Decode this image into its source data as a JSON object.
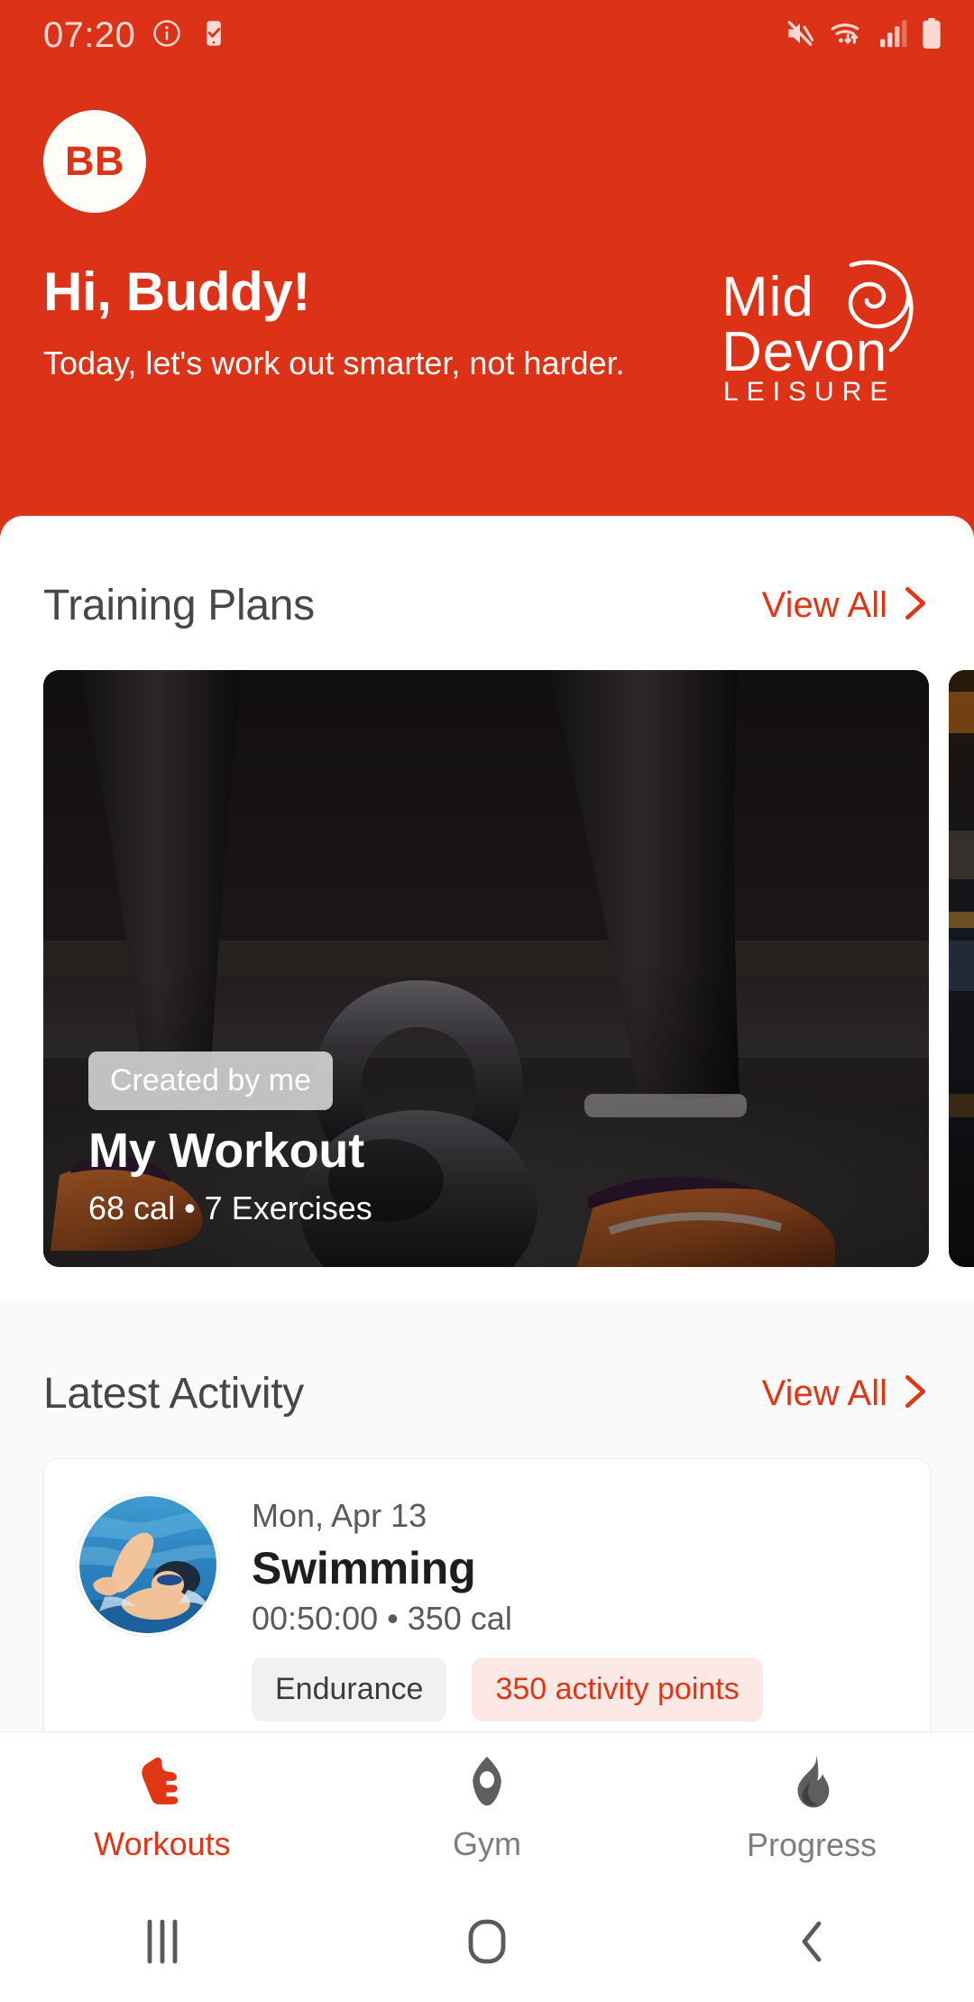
{
  "status_bar": {
    "time": "07:20",
    "left_icons": [
      "info-circle-icon",
      "phone-check-icon"
    ],
    "right_icons": [
      "mute-icon",
      "wifi-icon",
      "signal-icon",
      "battery-icon"
    ]
  },
  "header": {
    "background_color": "#DC3318",
    "avatar_initials": "BB",
    "greeting_title": "Hi, Buddy!",
    "greeting_subtitle": "Today, let's work out smarter, not harder.",
    "brand": {
      "line1": "Mid",
      "line2": "Devon",
      "line3": "LEISURE"
    }
  },
  "training_plans": {
    "section_title": "Training Plans",
    "view_all_label": "View All",
    "cards": [
      {
        "badge": "Created by me",
        "name": "My Workout",
        "meta": "68 cal • 7 Exercises",
        "image": "kettlebell-gym-photo"
      },
      {
        "badge": "",
        "name": "",
        "meta": "",
        "image": "gym-interior-photo"
      }
    ]
  },
  "latest_activity": {
    "section_title": "Latest Activity",
    "view_all_label": "View All",
    "items": [
      {
        "date": "Mon, Apr 13",
        "title": "Swimming",
        "stats": "00:50:00 • 350 cal",
        "chip_type": "Endurance",
        "chip_points": "350 activity points",
        "thumbnail": "swimmer-photo"
      }
    ]
  },
  "bottom_nav": {
    "items": [
      {
        "label": "Workouts",
        "icon": "running-shoe-icon",
        "active": true
      },
      {
        "label": "Gym",
        "icon": "location-pin-icon",
        "active": false
      },
      {
        "label": "Progress",
        "icon": "flame-icon",
        "active": false
      }
    ]
  },
  "system_nav": {
    "recents": "recents-icon",
    "home": "home-icon",
    "back": "back-icon"
  },
  "colors": {
    "brand_red": "#DC3318",
    "accent_red": "#E03616",
    "text_dark": "#1E1E1E",
    "text_muted": "#5A5A5A",
    "surface": "#FFFFFF",
    "surface_alt": "#FAFAFA"
  }
}
